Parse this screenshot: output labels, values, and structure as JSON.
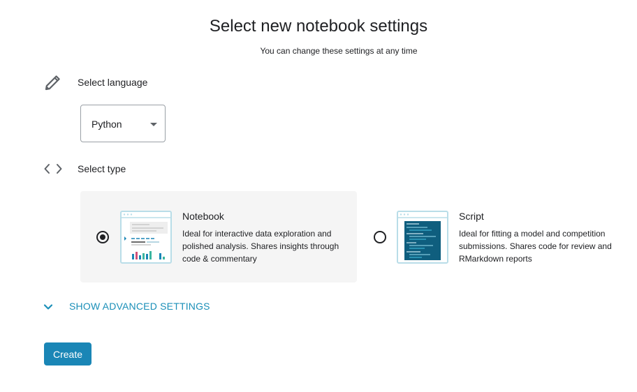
{
  "header": {
    "title": "Select new notebook settings",
    "subtitle": "You can change these settings at any time"
  },
  "language_section": {
    "icon": "pencil-icon",
    "label": "Select language",
    "selected": "Python"
  },
  "type_section": {
    "icon": "code-brackets-icon",
    "label": "Select type",
    "options": [
      {
        "title": "Notebook",
        "description": "Ideal for interactive data exploration and polished analysis. Shares insights through code & commentary",
        "selected": true,
        "thumbnail_icon": "notebook-preview-icon"
      },
      {
        "title": "Script",
        "description": "Ideal for fitting a model and competition submissions. Shares code for review and RMarkdown reports",
        "selected": false,
        "thumbnail_icon": "script-preview-icon"
      }
    ]
  },
  "advanced": {
    "label": "SHOW ADVANCED SETTINGS",
    "icon": "chevron-down-icon"
  },
  "actions": {
    "create_label": "Create"
  },
  "colors": {
    "accent": "#1a86b6",
    "link": "#1a8fb8",
    "card_selected_bg": "#f5f5f5",
    "script_dark": "#0f5e7e"
  }
}
